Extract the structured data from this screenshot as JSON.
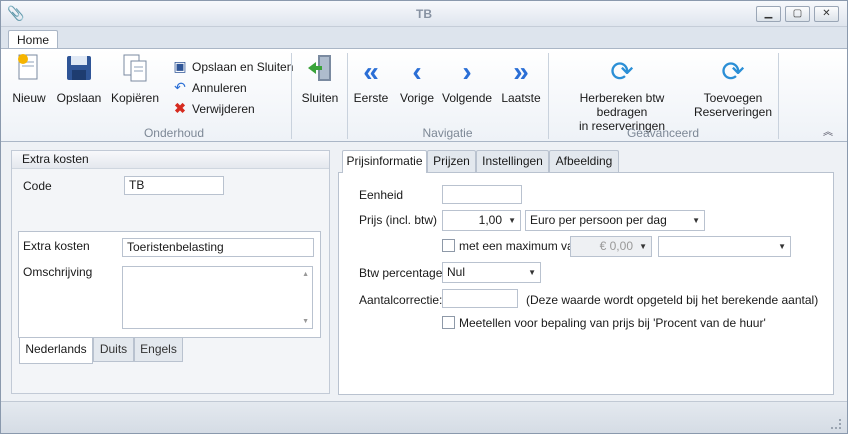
{
  "window": {
    "title": "TB",
    "minimize": "▁",
    "maximize": "▢",
    "close": "✕"
  },
  "ribbon": {
    "tab": "Home",
    "groups": {
      "onderhoud": {
        "label": "Onderhoud",
        "nieuw": "Nieuw",
        "opslaan": "Opslaan",
        "kopieren": "Kopiëren",
        "opslaan_sluiten": "Opslaan en Sluiten",
        "annuleren": "Annuleren",
        "verwijderen": "Verwijderen",
        "sluiten": "Sluiten"
      },
      "navigatie": {
        "label": "Navigatie",
        "eerste": "Eerste",
        "vorige": "Vorige",
        "volgende": "Volgende",
        "laatste": "Laatste"
      },
      "geavanceerd": {
        "label": "Geavanceerd",
        "herbereken_line1": "Herbereken btw bedragen",
        "herbereken_line2": "in reserveringen",
        "toevoegen_line1": "Toevoegen",
        "toevoegen_line2": "Reserveringen"
      }
    }
  },
  "left": {
    "header": "Extra kosten",
    "code_label": "Code",
    "code_value": "TB",
    "extra_kosten_label": "Extra kosten",
    "extra_kosten_value": "Toeristenbelasting",
    "omschrijving_label": "Omschrijving",
    "omschrijving_value": "",
    "tabs": [
      "Nederlands",
      "Duits",
      "Engels"
    ]
  },
  "right": {
    "tabs": [
      "Prijsinformatie",
      "Prijzen",
      "Instellingen",
      "Afbeelding"
    ],
    "eenheid_label": "Eenheid",
    "eenheid_value": "",
    "prijs_label": "Prijs (incl. btw)",
    "prijs_value": "1,00",
    "prijs_unit": "Euro per persoon per dag",
    "max_label": "met een maximum van",
    "max_value": "€ 0,00",
    "max_unit": "",
    "btw_label": "Btw percentage",
    "btw_value": "Nul",
    "aantal_label": "Aantalcorrectie:",
    "aantal_value": "",
    "aantal_note": "(Deze waarde wordt opgeteld bij het berekende aantal)",
    "meetellen_label": "Meetellen voor bepaling van prijs bij 'Procent van de huur'"
  }
}
